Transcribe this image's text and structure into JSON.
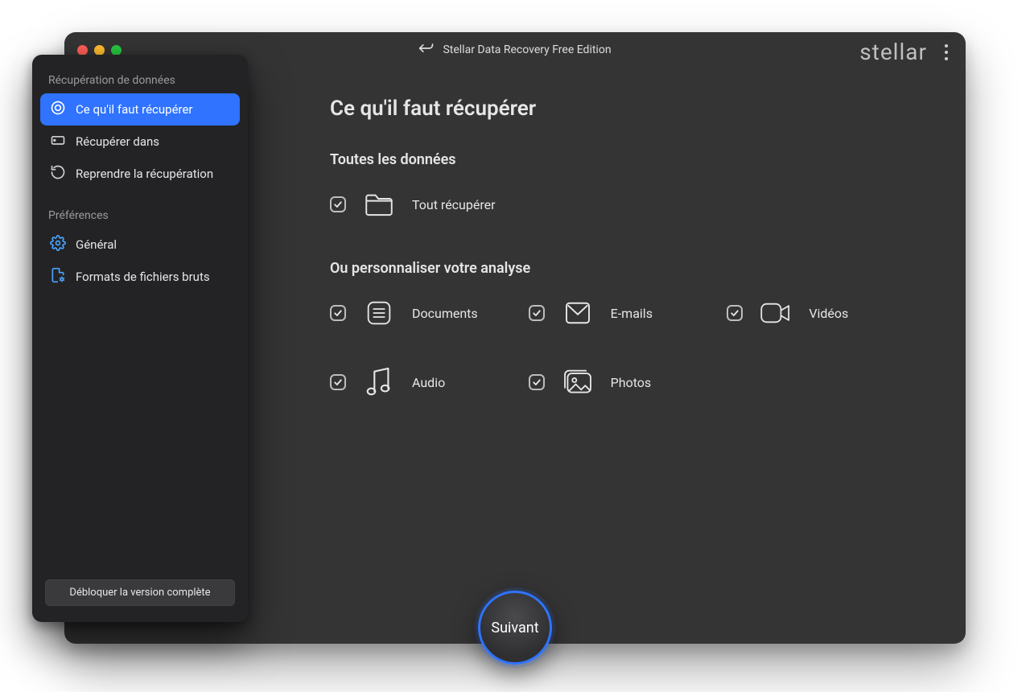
{
  "window": {
    "title": "Stellar Data Recovery Free Edition",
    "brand": "stellar"
  },
  "sidebar": {
    "sections": {
      "recovery_label": "Récupération de données",
      "prefs_label": "Préférences"
    },
    "items": {
      "what_to_recover": "Ce qu'il faut récupérer",
      "recover_in": "Récupérer dans",
      "resume_recovery": "Reprendre la récupération",
      "general": "Général",
      "raw_formats": "Formats de fichiers bruts"
    },
    "unlock_label": "Débloquer la version complète"
  },
  "main": {
    "heading": "Ce qu'il faut récupérer",
    "all_data_heading": "Toutes les données",
    "recover_all_label": "Tout récupérer",
    "customize_heading": "Ou personnaliser votre analyse",
    "options": {
      "documents": "Documents",
      "emails": "E-mails",
      "videos": "Vidéos",
      "audio": "Audio",
      "photos": "Photos"
    },
    "next_label": "Suivant"
  },
  "state": {
    "recover_all_checked": true,
    "documents_checked": true,
    "emails_checked": true,
    "videos_checked": true,
    "audio_checked": true,
    "photos_checked": true
  }
}
